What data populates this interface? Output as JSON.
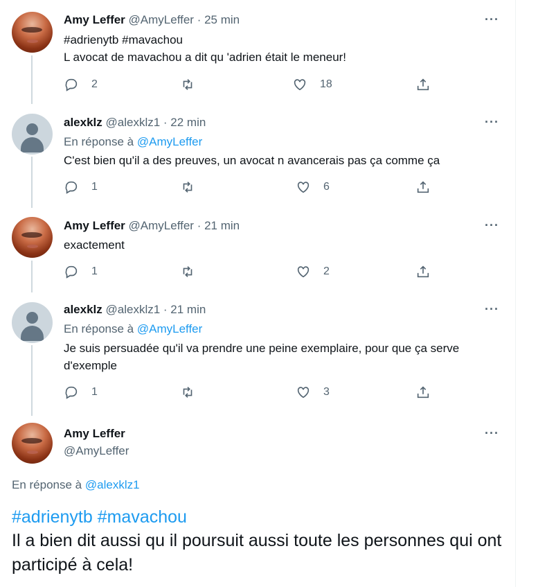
{
  "tweets": [
    {
      "name": "Amy Leffer",
      "meta": "@AmyLeffer · 25 min",
      "hashtags": "#adrienytb #mavachou",
      "text": "L avocat de mavachou a dit qu 'adrien était le meneur!",
      "replies": "2",
      "retweets": "",
      "likes": "18"
    },
    {
      "name": "alexklz",
      "meta": "@alexklz1 · 22 min",
      "reply_prefix": "En réponse à",
      "reply_handle": "@AmyLeffer",
      "text": "C'est bien qu'il a des preuves, un avocat n avancerais pas ça comme ça",
      "replies": "1",
      "retweets": "",
      "likes": "6"
    },
    {
      "name": "Amy Leffer",
      "meta": "@AmyLeffer · 21 min",
      "text": "exactement",
      "replies": "1",
      "retweets": "",
      "likes": "2"
    },
    {
      "name": "alexklz",
      "meta": "@alexklz1 · 21 min",
      "reply_prefix": "En réponse à",
      "reply_handle": "@AmyLeffer",
      "text": "Je suis persuadée qu'il va prendre une peine exemplaire, pour que ça serve d'exemple",
      "replies": "1",
      "retweets": "",
      "likes": "3"
    }
  ],
  "focus": {
    "name": "Amy Leffer",
    "handle": "@AmyLeffer",
    "reply_prefix": "En réponse à",
    "reply_handle": "@alexklz1",
    "hashtags": "#adrienytb #mavachou",
    "text": "Il a bien dit aussi qu il poursuit aussi toute les personnes qui ont participé à cela!"
  },
  "icons": {
    "more": "···",
    "reply": "reply-icon",
    "retweet": "retweet-icon",
    "like": "heart-icon",
    "share": "share-icon"
  },
  "colors": {
    "accent": "#1d9bf0",
    "secondary_text": "#536471",
    "primary_text": "#0f1419"
  }
}
